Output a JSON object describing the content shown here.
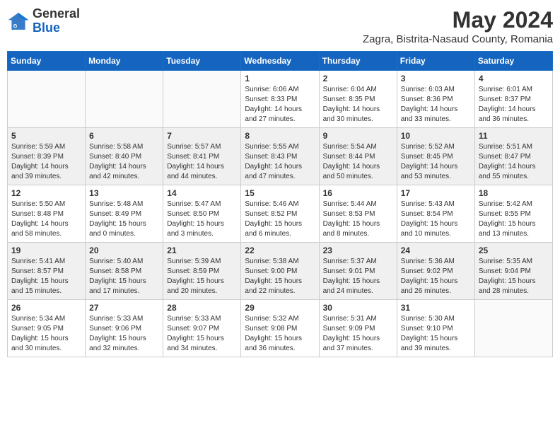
{
  "header": {
    "logo_general": "General",
    "logo_blue": "Blue",
    "month_year": "May 2024",
    "location": "Zagra, Bistrita-Nasaud County, Romania"
  },
  "weekdays": [
    "Sunday",
    "Monday",
    "Tuesday",
    "Wednesday",
    "Thursday",
    "Friday",
    "Saturday"
  ],
  "weeks": [
    [
      {
        "day": "",
        "info": ""
      },
      {
        "day": "",
        "info": ""
      },
      {
        "day": "",
        "info": ""
      },
      {
        "day": "1",
        "info": "Sunrise: 6:06 AM\nSunset: 8:33 PM\nDaylight: 14 hours and 27 minutes."
      },
      {
        "day": "2",
        "info": "Sunrise: 6:04 AM\nSunset: 8:35 PM\nDaylight: 14 hours and 30 minutes."
      },
      {
        "day": "3",
        "info": "Sunrise: 6:03 AM\nSunset: 8:36 PM\nDaylight: 14 hours and 33 minutes."
      },
      {
        "day": "4",
        "info": "Sunrise: 6:01 AM\nSunset: 8:37 PM\nDaylight: 14 hours and 36 minutes."
      }
    ],
    [
      {
        "day": "5",
        "info": "Sunrise: 5:59 AM\nSunset: 8:39 PM\nDaylight: 14 hours and 39 minutes."
      },
      {
        "day": "6",
        "info": "Sunrise: 5:58 AM\nSunset: 8:40 PM\nDaylight: 14 hours and 42 minutes."
      },
      {
        "day": "7",
        "info": "Sunrise: 5:57 AM\nSunset: 8:41 PM\nDaylight: 14 hours and 44 minutes."
      },
      {
        "day": "8",
        "info": "Sunrise: 5:55 AM\nSunset: 8:43 PM\nDaylight: 14 hours and 47 minutes."
      },
      {
        "day": "9",
        "info": "Sunrise: 5:54 AM\nSunset: 8:44 PM\nDaylight: 14 hours and 50 minutes."
      },
      {
        "day": "10",
        "info": "Sunrise: 5:52 AM\nSunset: 8:45 PM\nDaylight: 14 hours and 53 minutes."
      },
      {
        "day": "11",
        "info": "Sunrise: 5:51 AM\nSunset: 8:47 PM\nDaylight: 14 hours and 55 minutes."
      }
    ],
    [
      {
        "day": "12",
        "info": "Sunrise: 5:50 AM\nSunset: 8:48 PM\nDaylight: 14 hours and 58 minutes."
      },
      {
        "day": "13",
        "info": "Sunrise: 5:48 AM\nSunset: 8:49 PM\nDaylight: 15 hours and 0 minutes."
      },
      {
        "day": "14",
        "info": "Sunrise: 5:47 AM\nSunset: 8:50 PM\nDaylight: 15 hours and 3 minutes."
      },
      {
        "day": "15",
        "info": "Sunrise: 5:46 AM\nSunset: 8:52 PM\nDaylight: 15 hours and 6 minutes."
      },
      {
        "day": "16",
        "info": "Sunrise: 5:44 AM\nSunset: 8:53 PM\nDaylight: 15 hours and 8 minutes."
      },
      {
        "day": "17",
        "info": "Sunrise: 5:43 AM\nSunset: 8:54 PM\nDaylight: 15 hours and 10 minutes."
      },
      {
        "day": "18",
        "info": "Sunrise: 5:42 AM\nSunset: 8:55 PM\nDaylight: 15 hours and 13 minutes."
      }
    ],
    [
      {
        "day": "19",
        "info": "Sunrise: 5:41 AM\nSunset: 8:57 PM\nDaylight: 15 hours and 15 minutes."
      },
      {
        "day": "20",
        "info": "Sunrise: 5:40 AM\nSunset: 8:58 PM\nDaylight: 15 hours and 17 minutes."
      },
      {
        "day": "21",
        "info": "Sunrise: 5:39 AM\nSunset: 8:59 PM\nDaylight: 15 hours and 20 minutes."
      },
      {
        "day": "22",
        "info": "Sunrise: 5:38 AM\nSunset: 9:00 PM\nDaylight: 15 hours and 22 minutes."
      },
      {
        "day": "23",
        "info": "Sunrise: 5:37 AM\nSunset: 9:01 PM\nDaylight: 15 hours and 24 minutes."
      },
      {
        "day": "24",
        "info": "Sunrise: 5:36 AM\nSunset: 9:02 PM\nDaylight: 15 hours and 26 minutes."
      },
      {
        "day": "25",
        "info": "Sunrise: 5:35 AM\nSunset: 9:04 PM\nDaylight: 15 hours and 28 minutes."
      }
    ],
    [
      {
        "day": "26",
        "info": "Sunrise: 5:34 AM\nSunset: 9:05 PM\nDaylight: 15 hours and 30 minutes."
      },
      {
        "day": "27",
        "info": "Sunrise: 5:33 AM\nSunset: 9:06 PM\nDaylight: 15 hours and 32 minutes."
      },
      {
        "day": "28",
        "info": "Sunrise: 5:33 AM\nSunset: 9:07 PM\nDaylight: 15 hours and 34 minutes."
      },
      {
        "day": "29",
        "info": "Sunrise: 5:32 AM\nSunset: 9:08 PM\nDaylight: 15 hours and 36 minutes."
      },
      {
        "day": "30",
        "info": "Sunrise: 5:31 AM\nSunset: 9:09 PM\nDaylight: 15 hours and 37 minutes."
      },
      {
        "day": "31",
        "info": "Sunrise: 5:30 AM\nSunset: 9:10 PM\nDaylight: 15 hours and 39 minutes."
      },
      {
        "day": "",
        "info": ""
      }
    ]
  ]
}
